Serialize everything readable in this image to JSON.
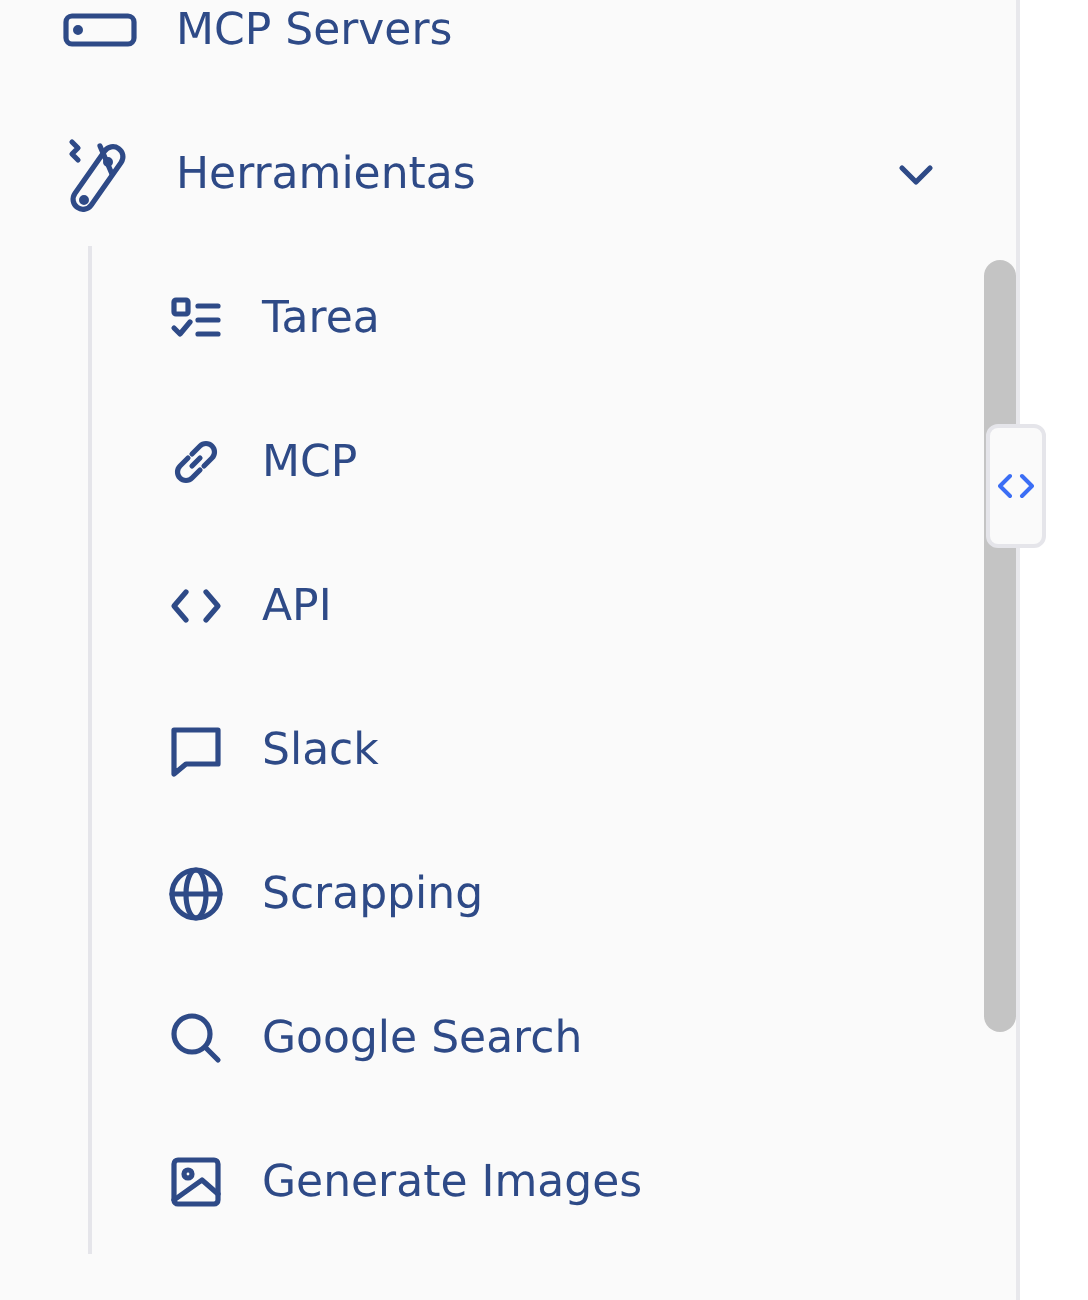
{
  "sidebar": {
    "items": [
      {
        "label": "MCP Servers"
      },
      {
        "label": "Herramientas",
        "expanded": true,
        "children": [
          {
            "label": "Tarea"
          },
          {
            "label": "MCP"
          },
          {
            "label": "API"
          },
          {
            "label": "Slack"
          },
          {
            "label": "Scrapping"
          },
          {
            "label": "Google Search"
          },
          {
            "label": "Generate Images"
          }
        ]
      }
    ]
  }
}
